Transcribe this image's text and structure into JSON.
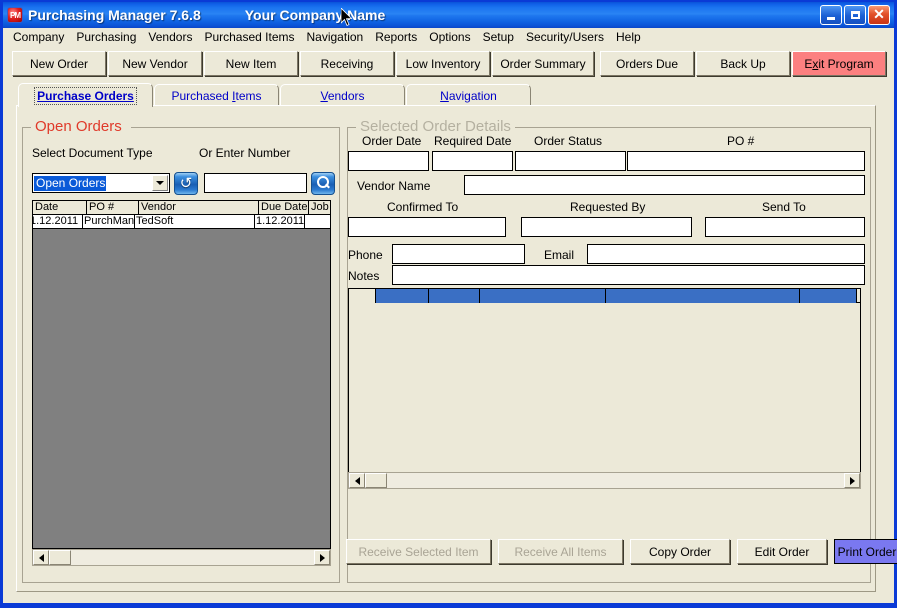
{
  "window": {
    "app_icon": "pm-logo-icon",
    "title": "Purchasing Manager 7.6.8",
    "company": "Your Company Name",
    "minimize_label": "Minimize",
    "maximize_label": "Maximize",
    "close_label": "Close",
    "accent_titlebar": "#1b74f0"
  },
  "menubar": {
    "items": [
      {
        "label": "Company"
      },
      {
        "label": "Purchasing"
      },
      {
        "label": "Vendors"
      },
      {
        "label": "Purchased Items"
      },
      {
        "label": "Navigation"
      },
      {
        "label": "Reports"
      },
      {
        "label": "Options"
      },
      {
        "label": "Setup"
      },
      {
        "label": "Security/Users"
      },
      {
        "label": "Help"
      }
    ]
  },
  "toolbar": {
    "buttons": [
      {
        "label": "New Order"
      },
      {
        "label": "New Vendor"
      },
      {
        "label": "New Item"
      },
      {
        "label": "Receiving"
      },
      {
        "label": "Low Inventory"
      },
      {
        "label": "Order Summary"
      },
      {
        "label": "Orders Due"
      },
      {
        "label": "Back Up"
      }
    ],
    "exit": {
      "label_pre": "E",
      "label_accel": "x",
      "label_post": "it Program",
      "color": "#fc8080"
    }
  },
  "tabs": [
    {
      "label": "Purchase Orders",
      "active": true
    },
    {
      "label_pre": "Purchased ",
      "label_accel": "I",
      "label_post": "tems",
      "active": false
    },
    {
      "label_pre": "",
      "label_accel": "V",
      "label_post": "endors",
      "active": false
    },
    {
      "label_pre": "",
      "label_accel": "N",
      "label_post": "avigation",
      "active": false
    }
  ],
  "open_orders": {
    "group_title": "Open Orders",
    "group_title_color": "#e03a2a",
    "label_doc_type": "Select Document Type",
    "label_enter_number": "Or Enter Number",
    "combo_value": "Open Orders",
    "refresh_icon": "refresh-icon",
    "search_icon": "search-icon",
    "number_value": "",
    "grid": {
      "columns": [
        "Date",
        "PO #",
        "Vendor",
        "Due Date",
        "Job No"
      ],
      "rows": [
        [
          "1.12.2011",
          "PurchMan",
          "TedSoft",
          "1.12.2011",
          ""
        ]
      ]
    },
    "scroll_left_icon": "arrow-left-icon",
    "scroll_right_icon": "arrow-right-icon"
  },
  "order_details": {
    "group_title": "Selected Order Details",
    "group_title_color": "#b4b0a0",
    "labels": {
      "order_date": "Order Date",
      "required_date": "Required Date",
      "order_status": "Order Status",
      "po_number": "PO #",
      "vendor_name": "Vendor Name",
      "confirmed_to": "Confirmed To",
      "requested_by": "Requested By",
      "send_to": "Send To",
      "phone": "Phone",
      "email": "Email",
      "notes": "Notes"
    },
    "values": {
      "order_date": "",
      "required_date": "",
      "order_status": "",
      "po_number": "",
      "vendor_name": "",
      "confirmed_to": "",
      "requested_by": "",
      "send_to": "",
      "phone": "",
      "email": "",
      "notes": ""
    },
    "items_grid": {
      "header_color": "#3a6fc4",
      "columns": [
        "",
        "",
        "",
        "",
        "",
        ""
      ],
      "rows": []
    },
    "scroll_left_icon": "arrow-left-icon",
    "scroll_right_icon": "arrow-right-icon"
  },
  "actions": [
    {
      "label": "Receive Selected Item",
      "state": "disabled"
    },
    {
      "label": "Receive All Items",
      "state": "disabled"
    },
    {
      "label": "Copy Order",
      "state": "enabled"
    },
    {
      "label": "Edit Order",
      "state": "enabled"
    },
    {
      "label": "Print Order",
      "state": "highlighted",
      "color": "#7a78f0"
    }
  ]
}
